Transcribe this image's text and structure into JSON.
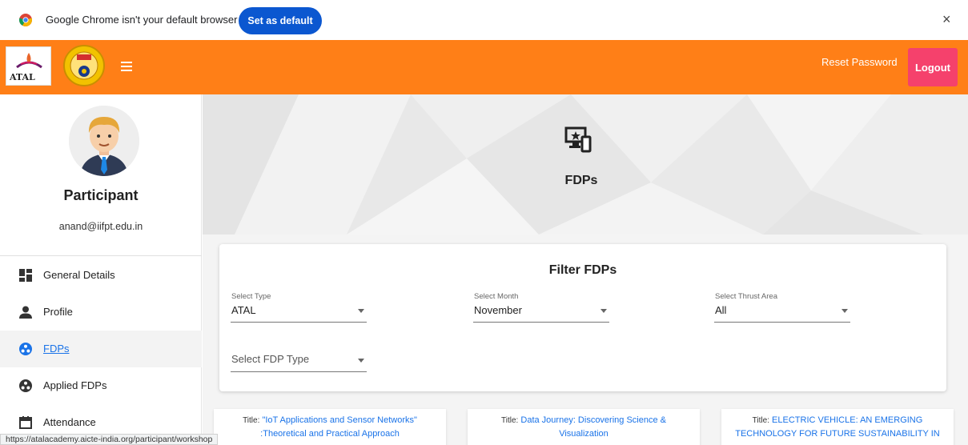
{
  "infobar": {
    "message": "Google Chrome isn't your default browser",
    "set_default_label": "Set as default",
    "close_glyph": "×"
  },
  "header": {
    "atal_logo_text": "ATAL",
    "aicte_logo_text": "AICTE",
    "reset_password_label": "Reset Password",
    "logout_label": "Logout",
    "colors": {
      "bar": "#ff7f17",
      "logout": "#f5416c"
    }
  },
  "sidebar": {
    "role": "Participant",
    "email": "anand@iifpt.edu.in",
    "items": [
      {
        "label": "General Details",
        "icon": "dashboard-icon"
      },
      {
        "label": "Profile",
        "icon": "person-icon"
      },
      {
        "label": "FDPs",
        "icon": "group-icon"
      },
      {
        "label": "Applied FDPs",
        "icon": "group-icon"
      },
      {
        "label": "Attendance",
        "icon": "calendar-icon"
      }
    ]
  },
  "main": {
    "page_title": "FDPs",
    "filter": {
      "title": "Filter FDPs",
      "type": {
        "label": "Select Type",
        "value": "ATAL"
      },
      "month": {
        "label": "Select Month",
        "value": "November"
      },
      "thrust": {
        "label": "Select Thrust Area",
        "value": "All"
      },
      "fdp_type": {
        "placeholder": "Select FDP Type"
      }
    },
    "cards": [
      {
        "title_label": "Title:",
        "line1": "\"IoT Applications and Sensor Networks\"",
        "line2": ":Theoretical and Practical Approach"
      },
      {
        "title_label": "Title:",
        "line1": "Data Journey: Discovering Science &",
        "line2": "Visualization"
      },
      {
        "title_label": "Title:",
        "line1": "ELECTRIC VEHICLE: AN EMERGING",
        "line2": "TECHNOLOGY FOR FUTURE SUSTAINABILITY IN"
      }
    ]
  },
  "status_bar": {
    "url": "https://atalacademy.aicte-india.org/participant/workshop"
  }
}
